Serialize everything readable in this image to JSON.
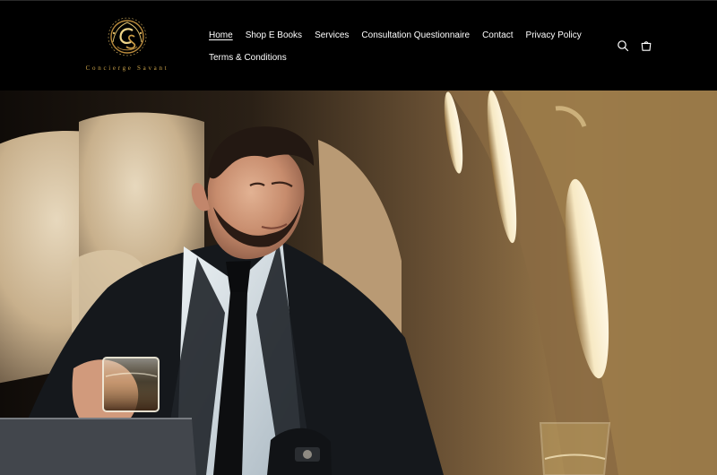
{
  "brand": {
    "name": "Concierge Savant",
    "monogram": "CS",
    "accent_color": "#c9a24a"
  },
  "header": {
    "background": "#000000",
    "nav": [
      {
        "label": "Home",
        "active": true
      },
      {
        "label": "Shop E Books"
      },
      {
        "label": "Services"
      },
      {
        "label": "Consultation Questionnaire"
      },
      {
        "label": "Contact"
      },
      {
        "label": "Privacy Policy"
      },
      {
        "label": "Terms & Conditions"
      }
    ],
    "icons": {
      "search": "search-icon",
      "cart": "cart-icon"
    }
  },
  "hero": {
    "image": "businessman-in-private-jet",
    "palette": {
      "cabin": "#8b6a42",
      "seat": "#d9c7a6",
      "suit": "#16191d",
      "shirt": "#dbe3e8"
    }
  }
}
